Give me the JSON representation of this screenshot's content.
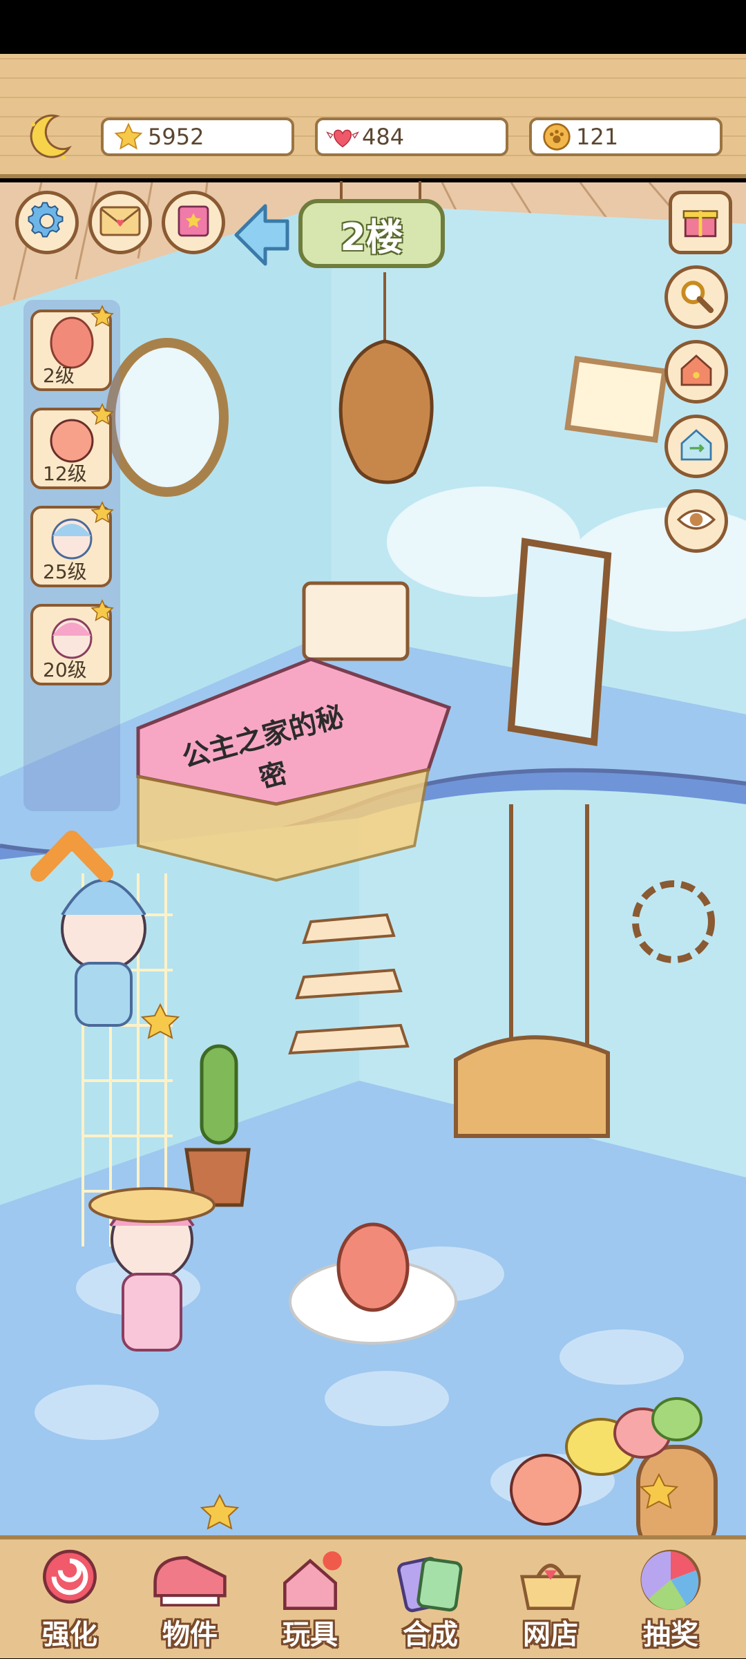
{
  "resources": {
    "stars": "5952",
    "hearts": "484",
    "coins": "121"
  },
  "toolbar": {
    "icons": [
      "settings-gear-icon",
      "mail-envelope-icon",
      "star-book-icon",
      "back-arrow-icon"
    ]
  },
  "floor_sign": "2楼",
  "characters": [
    {
      "level": "2级",
      "badge": "1"
    },
    {
      "level": "12级",
      "badge": "1"
    },
    {
      "level": "25级",
      "badge": "1"
    },
    {
      "level": "20级",
      "badge": "1"
    }
  ],
  "right_buttons": [
    "gift-icon",
    "magnifier-icon",
    "pet-house-icon",
    "house-swap-icon",
    "eye-icon"
  ],
  "book_title": "公主之家的秘密",
  "bottom_nav": {
    "items": [
      {
        "label": "强化",
        "icon": "lollipop-icon"
      },
      {
        "label": "物件",
        "icon": "piano-icon"
      },
      {
        "label": "玩具",
        "icon": "toy-house-icon"
      },
      {
        "label": "合成",
        "icon": "cards-icon"
      },
      {
        "label": "网店",
        "icon": "shop-basket-icon"
      },
      {
        "label": "抽奖",
        "icon": "prize-wheel-icon"
      }
    ]
  },
  "colors": {
    "wood": "#e7c48f",
    "wall": "#bfe7ef",
    "floor": "#9ec8ef",
    "accent": "#f19a3e"
  }
}
